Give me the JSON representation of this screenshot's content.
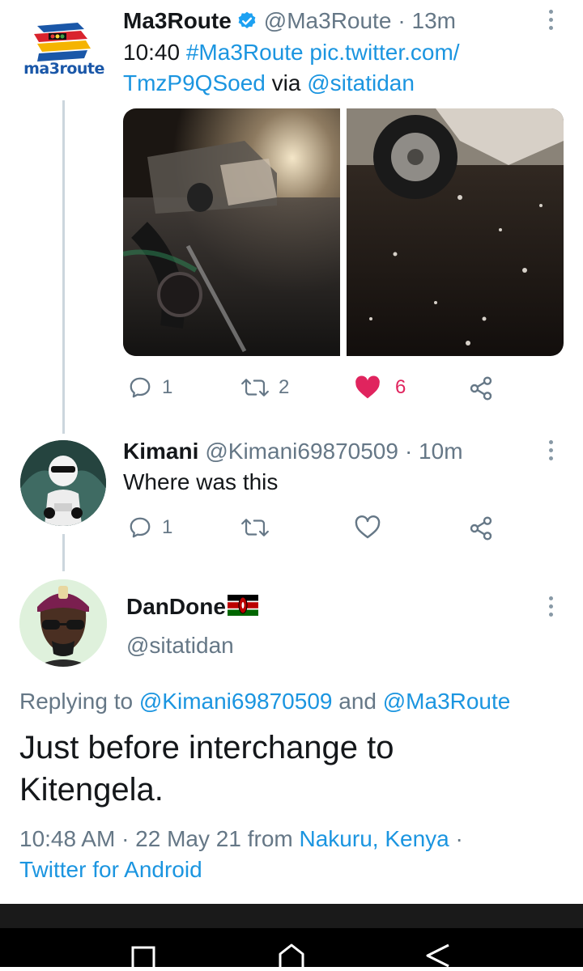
{
  "tweet1": {
    "name": "Ma3Route",
    "handle": "@Ma3Route",
    "time": "· 13m",
    "text_time": "10:40",
    "hashtag": "#Ma3Route",
    "link1": "pic.twitter.com/",
    "link2": "TmzP9QSoed",
    "via": "via",
    "via_handle": "@sitatidan",
    "logo_text": "ma3route",
    "replies": "1",
    "retweets": "2",
    "likes": "6",
    "like_color": "#e0245e"
  },
  "tweet2": {
    "name": "Kimani",
    "handle": "@Kimani69870509",
    "time": "· 10m",
    "text": "Where was this",
    "replies": "1"
  },
  "tweet3": {
    "name": "DanDone",
    "handle": "@sitatidan",
    "replying_prefix": "Replying to",
    "reply_to_1": "@Kimani69870509",
    "reply_and": "and",
    "reply_to_2": "@Ma3Route",
    "text_line1": "Just before interchange to",
    "text_line2": "Kitengela.",
    "timestamp": "10:48 AM · 22 May 21 from",
    "location": "Nakuru, Kenya",
    "dot": "·",
    "source": "Twitter for Android"
  },
  "colors": {
    "link": "#1b95e0",
    "verified": "#1da1f2",
    "muted": "#657786"
  },
  "icons": [
    "verified-badge-icon",
    "reply-icon",
    "retweet-icon",
    "like-icon",
    "share-icon",
    "more-icon",
    "kenya-flag-icon",
    "nav-recents-icon",
    "nav-home-icon",
    "nav-back-icon"
  ]
}
